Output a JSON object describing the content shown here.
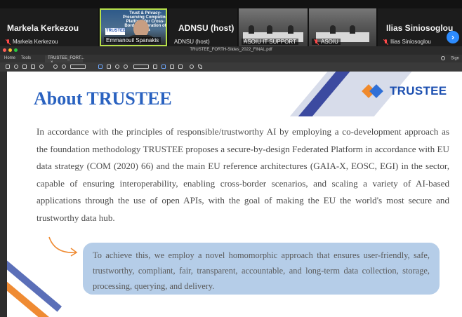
{
  "zoom": {
    "participants": [
      {
        "display_name": "Markela Kerkezou",
        "label": "Markela Kerkezou",
        "muted": true,
        "kind": "name_tile"
      },
      {
        "label": "Emmanouil Spanakis",
        "muted": false,
        "kind": "speaker_video",
        "shared_slide_text": "Trust & Privacy-Preserving Computing Platform for Cross-Border Federation of Data",
        "shared_slide_logo": "TRUSTEE"
      },
      {
        "display_name": "ADNSU (host)",
        "label": "ADNSU (host)",
        "muted": false,
        "kind": "name_tile"
      },
      {
        "label": "ASOIU IT SUPPORT",
        "muted": false,
        "kind": "room_video"
      },
      {
        "label": "ASOIU",
        "muted": true,
        "kind": "room_video"
      },
      {
        "display_name": "Ilias Siniosoglou",
        "label": "Ilias Siniosoglou",
        "muted": true,
        "kind": "name_tile"
      }
    ],
    "next_page_icon": "chevron-right-icon"
  },
  "viewer": {
    "file_name": "TRUSTEE_FORTH-Slides_2022_FINAL.pdf",
    "nav_home": "Home",
    "nav_tools": "Tools",
    "doc_tab": "TRUSTEE_FORT...",
    "doc_tab_close": "×",
    "help_icon": "help-icon",
    "signin": "Sign"
  },
  "slide": {
    "title": "About TRUSTEE",
    "logo_text": "TRUSTEE",
    "paragraph": "In accordance with the principles of responsible/trustworthy AI by employing a co-development approach as the foundation methodology TRUSTEE proposes a secure-by-design Federated Platform in accordance with EU data strategy (COM (2020) 66) and the main EU reference architectures (GAIA-X, EOSC, EGI) in the sector, capable of ensuring interoperability, enabling cross-border scenarios, and scaling a variety of AI-based applications through the use of open APIs, with the goal of making the EU the world's most secure and trustworthy data hub.",
    "callout": "To achieve this, we employ a novel homomorphic approach that ensures user-friendly, safe, trustworthy, compliant, fair, transparent, accountable, and long-term data collection, storage, processing, querying, and delivery."
  },
  "colors": {
    "title_blue": "#2a62c0",
    "logo_blue": "#1c4fb0",
    "logo_orange": "#f08a2c",
    "callout_bg": "#b5cde8",
    "zoom_blue": "#2d8cff",
    "active_speaker": "#b7e04a"
  }
}
